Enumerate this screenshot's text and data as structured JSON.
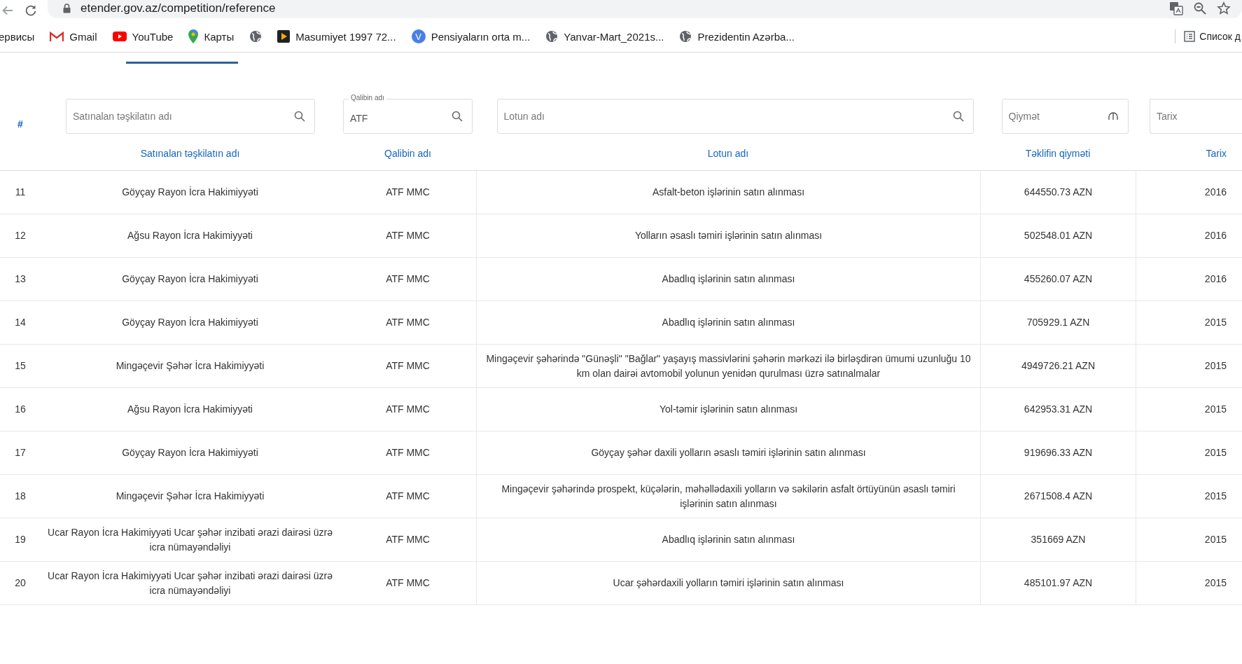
{
  "browser": {
    "url": "etender.gov.az/competition/reference",
    "bookmarks": [
      {
        "kind": "plain",
        "label": "ервисы"
      },
      {
        "kind": "gmail",
        "label": "Gmail"
      },
      {
        "kind": "youtube",
        "label": "YouTube"
      },
      {
        "kind": "maps",
        "label": "Карты"
      },
      {
        "kind": "globe"
      },
      {
        "kind": "video",
        "label": "Masumiyet 1997 72..."
      },
      {
        "kind": "letter",
        "label": "Pensiyaların orta m...",
        "icon_text": "V"
      },
      {
        "kind": "globe",
        "label": "Yanvar-Mart_2021s..."
      },
      {
        "kind": "globe",
        "label": "Prezidentin Azərba..."
      }
    ],
    "reading_list": "Список д"
  },
  "filters": [
    {
      "kind": "search",
      "placeholder": "Satınalan təşkilatın adı"
    },
    {
      "kind": "search",
      "label": "Qalibin adı",
      "value": "ATF"
    },
    {
      "kind": "search",
      "placeholder": "Lotun adı"
    },
    {
      "kind": "range",
      "placeholder": "Qiymət"
    },
    {
      "kind": "plain",
      "placeholder": "Tarix"
    }
  ],
  "index_header": "#",
  "columns": [
    "Satınalan təşkilatın adı",
    "Qalibin adı",
    "Lotun adı",
    "Təklifin qiyməti",
    "Tarix"
  ],
  "rows": [
    {
      "number": "11",
      "organization": "Göyçay Rayon İcra Hakimiyyəti",
      "winner": "ATF MMC",
      "lot": "Asfalt-beton işlərinin satın alınması",
      "price": "644550.73 AZN",
      "year": "2016"
    },
    {
      "number": "12",
      "organization": "Ağsu Rayon İcra Hakimiyyəti",
      "winner": "ATF MMC",
      "lot": "Yolların əsaslı təmiri işlərinin satın alınması",
      "price": "502548.01 AZN",
      "year": "2016"
    },
    {
      "number": "13",
      "organization": "Göyçay Rayon İcra Hakimiyyəti",
      "winner": "ATF MMC",
      "lot": "Abadlıq işlərinin satın alınması",
      "price": "455260.07 AZN",
      "year": "2016"
    },
    {
      "number": "14",
      "organization": "Göyçay Rayon İcra Hakimiyyəti",
      "winner": "ATF MMC",
      "lot": "Abadlıq işlərinin satın alınması",
      "price": "705929.1 AZN",
      "year": "2015"
    },
    {
      "number": "15",
      "organization": "Mingəçevir Şəhər İcra Hakimiyyəti",
      "winner": "ATF MMC",
      "lot": "Mingəçevir şəhərində \"Günəşli\" \"Bağlar\" yaşayış massivlərini şəhərin mərkəzi ilə birləşdirən ümumi uzunluğu 10 km olan dairəi avtomobil yolunun yenidən qurulması üzrə satınalmalar",
      "price": "4949726.21 AZN",
      "year": "2015"
    },
    {
      "number": "16",
      "organization": "Ağsu Rayon İcra Hakimiyyəti",
      "winner": "ATF MMC",
      "lot": "Yol-təmir işlərinin satın alınması",
      "price": "642953.31 AZN",
      "year": "2015"
    },
    {
      "number": "17",
      "organization": "Göyçay Rayon İcra Hakimiyyəti",
      "winner": "ATF MMC",
      "lot": "Göyçay şəhər daxili yolların əsaslı təmiri işlərinin satın alınması",
      "price": "919696.33 AZN",
      "year": "2015"
    },
    {
      "number": "18",
      "organization": "Mingəçevir Şəhər İcra Hakimiyyəti",
      "winner": "ATF MMC",
      "lot": "Mingəçevir şəhərində prospekt, küçələrin, məhəllədaxili yolların və səkilərin asfalt örtüyünün əsaslı təmiri işlərinin satın alınması",
      "price": "2671508.4 AZN",
      "year": "2015"
    },
    {
      "number": "19",
      "organization": "Ucar Rayon İcra Hakimiyyəti Ucar şəhər inzibati ərazi dairəsi üzrə icra nümayəndəliyi",
      "winner": "ATF MMC",
      "lot": "Abadlıq işlərinin satın alınması",
      "price": "351669 AZN",
      "year": "2015"
    },
    {
      "number": "20",
      "organization": "Ucar Rayon İcra Hakimiyyəti Ucar şəhər inzibati ərazi dairəsi üzrə icra nümayəndəliyi",
      "winner": "ATF MMC",
      "lot": "Ucar şəhərdaxili yolların təmiri işlərinin satın alınması",
      "price": "485101.97 AZN",
      "year": "2015"
    }
  ]
}
